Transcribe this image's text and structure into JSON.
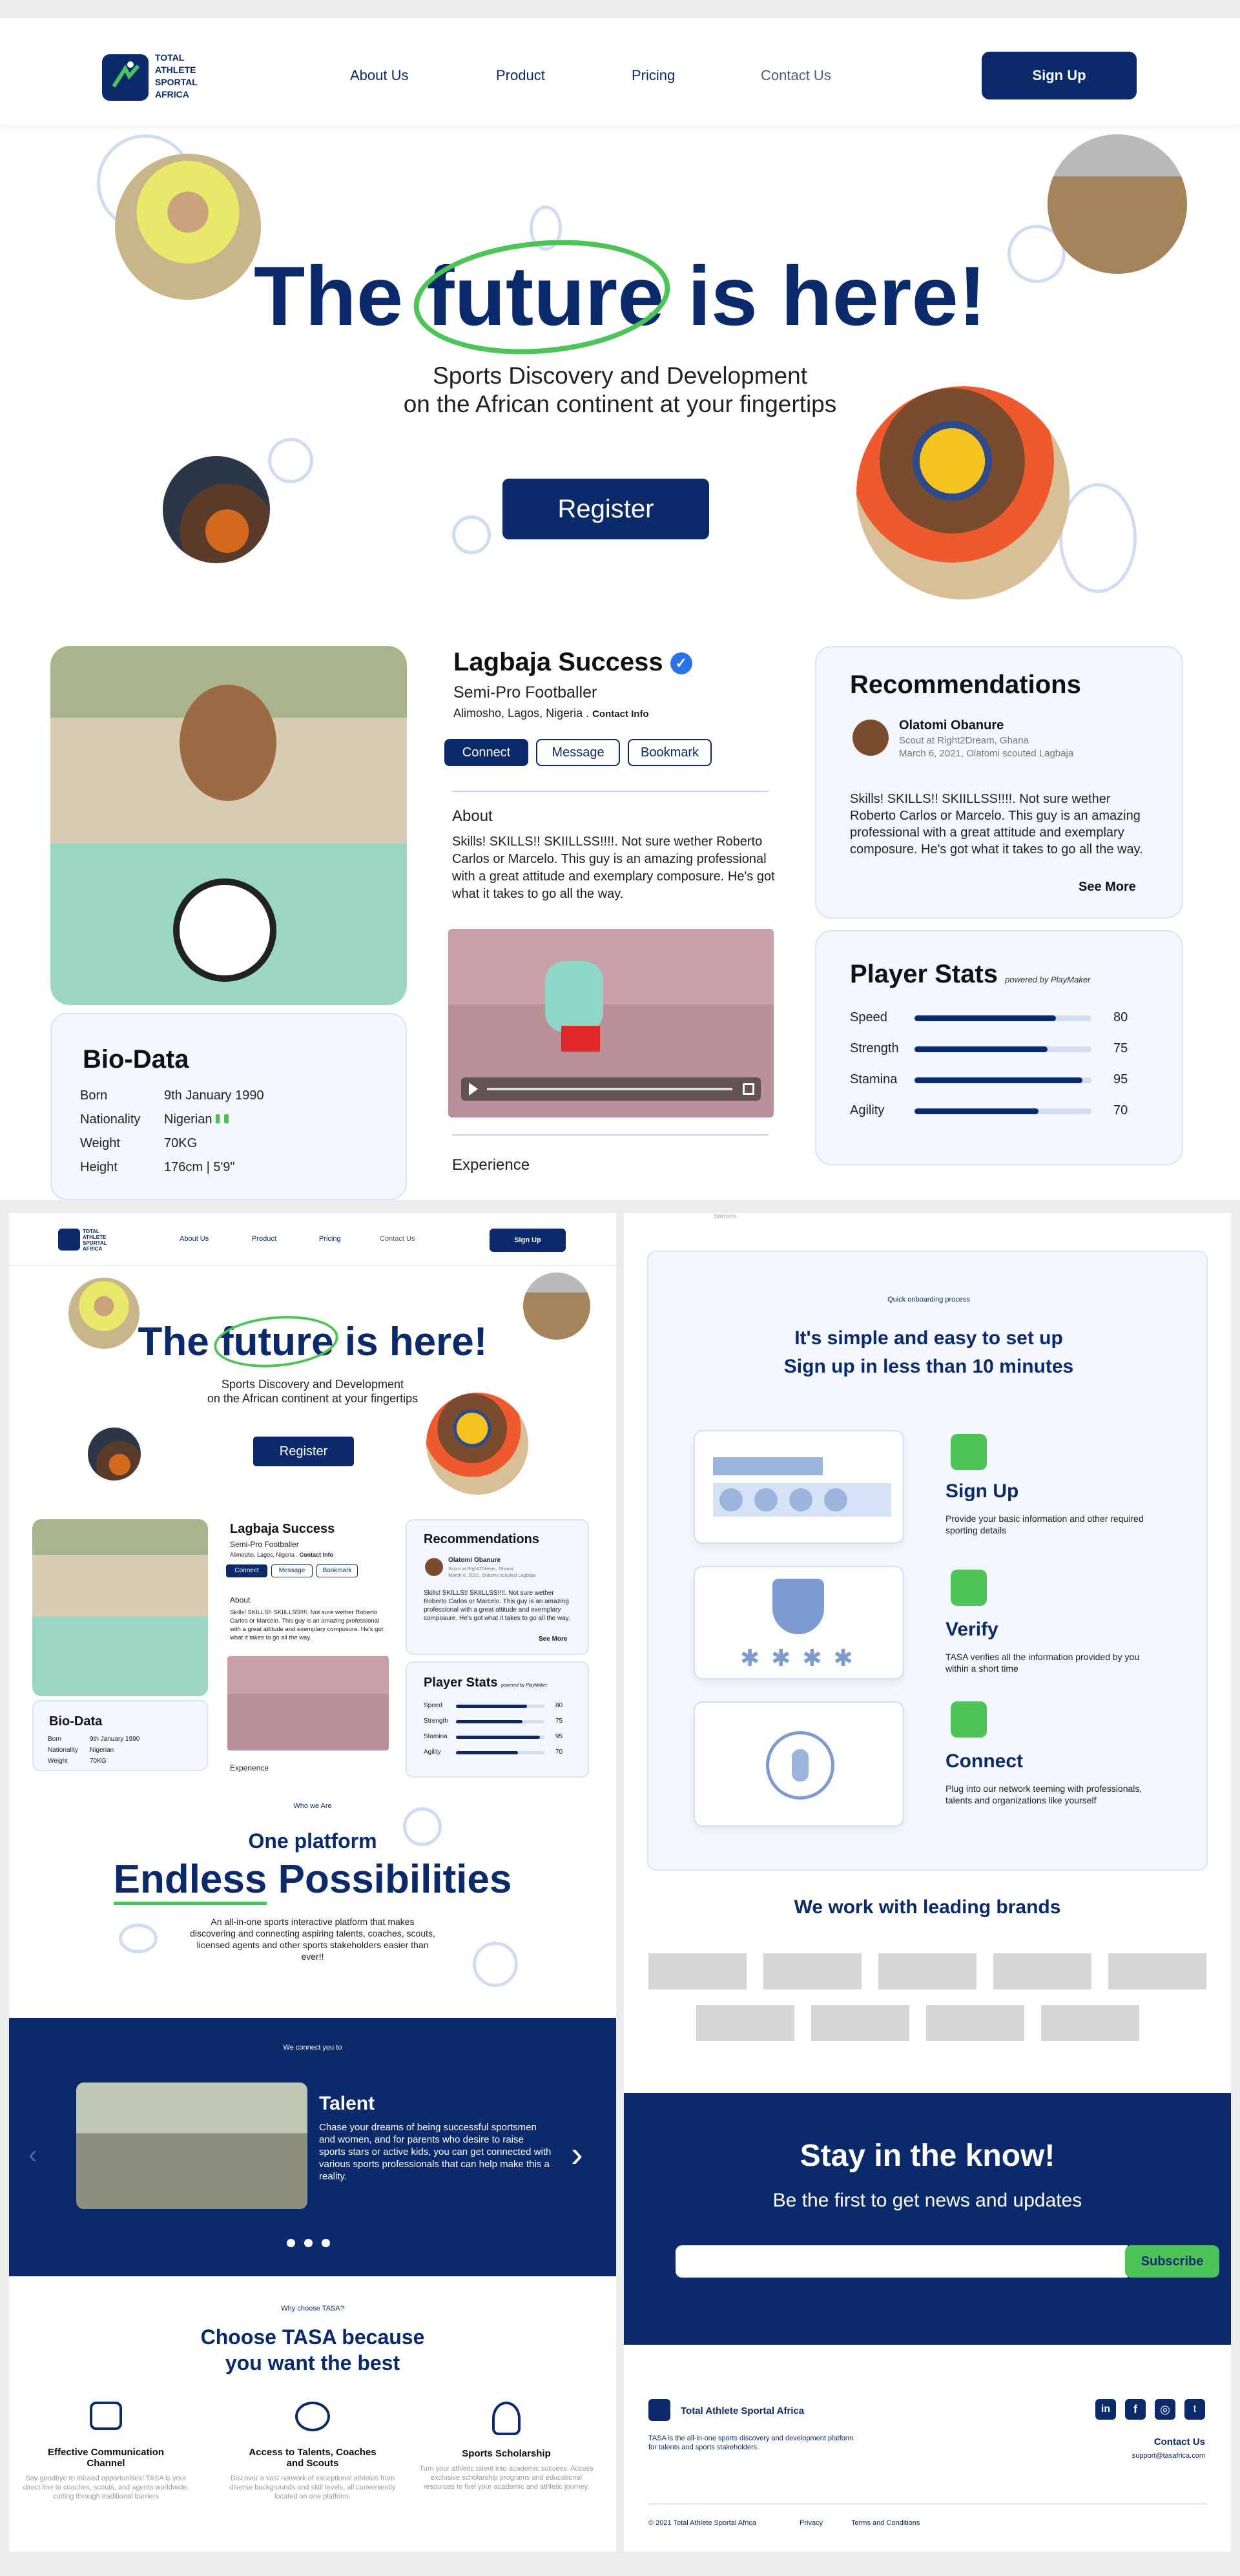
{
  "brand": {
    "logo_text": "TOTAL ATHLETE SPORTAL AFRICA",
    "logo_lines": [
      "TOTAL",
      "ATHLETE",
      "SPORTAL",
      "AFRICA"
    ]
  },
  "nav": {
    "items": [
      "About Us",
      "Product",
      "Pricing",
      "Contact Us"
    ],
    "signup": "Sign Up"
  },
  "hero": {
    "title_pre": "The ",
    "title_highlight": "future",
    "title_post": " is here!",
    "subtitle_line1": "Sports Discovery and Development",
    "subtitle_line2": "on the African continent at your fingertips",
    "register": "Register"
  },
  "profile": {
    "name": "Lagbaja Success",
    "role": "Semi-Pro Footballer",
    "location": "Alimosho, Lagos, Nigeria . ",
    "contact": "Contact Info",
    "buttons": [
      "Connect",
      "Message",
      "Bookmark"
    ],
    "about_heading": "About",
    "about_text": "Skills! SKILLS!! SKIILLSS!!!!. Not sure wether Roberto Carlos or Marcelo. This guy is an amazing professional with a great attitude and exemplary composure. He's got what it takes to go all the way.",
    "experience_heading": "Experience"
  },
  "biodata": {
    "heading": "Bio-Data",
    "rows": [
      [
        "Born",
        "9th January 1990"
      ],
      [
        "Nationality",
        "Nigerian"
      ],
      [
        "Weight",
        "70KG"
      ],
      [
        "Height",
        "176cm | 5'9\""
      ]
    ]
  },
  "recommendations": {
    "heading": "Recommendations",
    "name": "Olatomi Obanure",
    "title": "Scout at Right2Dream, Ghana",
    "date": "March 6, 2021, Olatomi scouted Lagbaja",
    "text": "Skills! SKILLS!! SKIILLSS!!!!. Not sure wether Roberto Carlos or Marcelo. This guy is an amazing professional with a great attitude and exemplary composure. He's got what it takes to go all the way.",
    "see_more": "See More"
  },
  "stats": {
    "heading": "Player Stats",
    "powered": "powered by PlayMaker",
    "items": [
      {
        "label": "Speed",
        "value": 80
      },
      {
        "label": "Strength",
        "value": 75
      },
      {
        "label": "Stamina",
        "value": 95
      },
      {
        "label": "Agility",
        "value": 70
      }
    ]
  },
  "who": {
    "eyebrow": "Who we Are",
    "line1": "One platform",
    "line2_a": "Endless",
    "line2_b": " Possibilities",
    "text": "An all-in-one sports interactive platform that makes discovering and connecting aspiring talents, coaches, scouts, licensed agents and other sports stakeholders easier than ever!!"
  },
  "connect": {
    "eyebrow": "We connect you to",
    "title": "Talent",
    "text": "Chase your dreams of being successful sportsmen and women, and for parents who desire to raise sports stars or active kids, you can get connected with various sports professionals that can help make this a reality."
  },
  "why": {
    "eyebrow": "Why choose TASA?",
    "title1": "Choose TASA because",
    "title2": "you want the best",
    "features": [
      {
        "title": "Effective Communication Channel",
        "text": "Say goodbye to missed opportunities! TASA is your direct line to coaches, scouts, and agents worldwide, cutting through traditional barriers"
      },
      {
        "title": "Access to Talents, Coaches and Scouts",
        "text": "Discover a vast network of exceptional athletes from diverse backgrounds and skill levels, all conveniently located on one platform."
      },
      {
        "title": "Sports Scholarship",
        "text": "Turn your athletic talent into academic success. Access exclusive scholarship programs and educational resources to fuel your academic and athletic journey."
      }
    ]
  },
  "onboarding": {
    "eyebrow": "Quick onboarding process",
    "title1": "It's simple and easy to set up",
    "title2": "Sign up in less than 10 minutes",
    "steps": [
      {
        "title": "Sign Up",
        "text": "Provide your basic information and other required sporting details"
      },
      {
        "title": "Verify",
        "text": "TASA verifies all the information provided by you within a short time"
      },
      {
        "title": "Connect",
        "text": "Plug into our network teeming with professionals, talents and organizations like yourself"
      }
    ]
  },
  "brands": {
    "heading": "We work with leading brands"
  },
  "newsletter": {
    "title": "Stay in the know!",
    "subtitle": "Be the first to get news and updates",
    "placeholder": "",
    "button": "Subscribe"
  },
  "footer": {
    "name": "Total Athlete Sportal Africa",
    "desc": "TASA is the all-in-one sports discovery and development platform for talents and sports stakeholders.",
    "contact": "Contact Us",
    "email": "support@tasafrica.com",
    "copyright": "© 2021 Total Athlete Sportal Africa",
    "privacy": "Privacy",
    "terms": "Terms and Conditions",
    "barriers": "barriers"
  },
  "colors": {
    "navy": "#0b2a6b",
    "green": "#4cc457",
    "light": "#f4f7fd"
  }
}
